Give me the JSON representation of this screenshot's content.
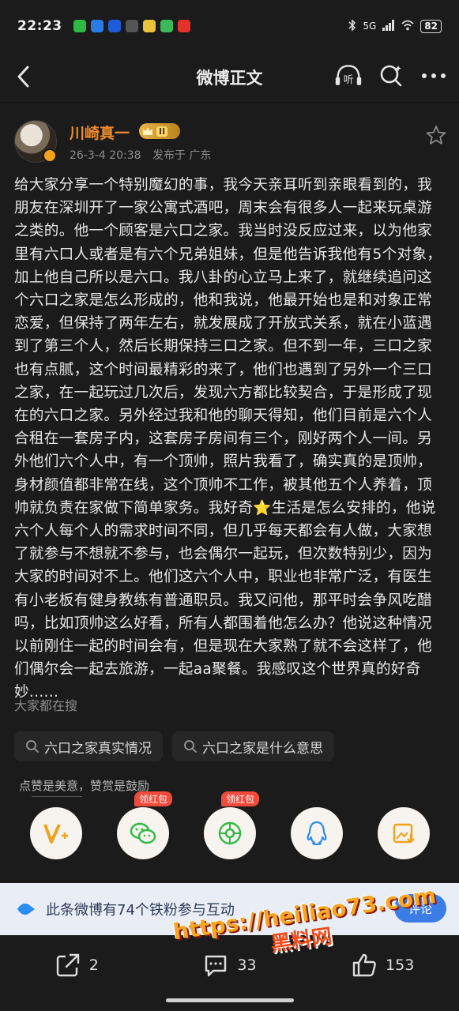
{
  "status_bar": {
    "time": "22:23",
    "signal": "5G",
    "battery": "82"
  },
  "nav": {
    "title": "微博正文",
    "listen_label": "听"
  },
  "post": {
    "author": "川崎真一",
    "vip_level": "II",
    "timestamp": "26-3-4 20:38",
    "location": "发布于 广东",
    "body": "给大家分享一个特别魔幻的事，我今天亲耳听到亲眼看到的，我朋友在深圳开了一家公寓式酒吧，周末会有很多人一起来玩桌游之类的。他一个顾客是六口之家。我当时没反应过来，以为他家里有六口人或者是有六个兄弟姐妹，但是他告诉我他有5个对象，加上他自己所以是六口。我八卦的心立马上来了，就继续追问这个六口之家是怎么形成的，他和我说，他最开始也是和对象正常恋爱，但保持了两年左右，就发展成了开放式关系，就在小蓝遇到了第三个人，然后长期保持三口之家。但不到一年，三口之家也有点腻，这个时间最精彩的来了，他们也遇到了另外一个三口之家，在一起玩过几次后，发现六方都比较契合，于是形成了现在的六口之家。另外经过我和他的聊天得知，他们目前是六个人合租在一套房子内，这套房子房间有三个，刚好两个人一间。另外他们六个人中，有一个顶帅，照片我看了，确实真的是顶帅，身材颜值都非常在线，这个顶帅不工作，被其他五个人养着，顶帅就负责在家做下简单家务。我好奇⭐生活是怎么安排的，他说六个人每个人的需求时间不同，但几乎每天都会有人做，大家想了就参与不想就不参与，也会偶尔一起玩，但次数特别少，因为大家的时间对不上。他们这六个人中，职业也非常广泛，有医生有小老板有健身教练有普通职员。我又问他，那平时会争风吃醋吗，比如顶帅这么好看，所有人都围着他怎么办？他说这种情况以前刚住一起的时间会有，但是现在大家熟了就不会这样了，他们偶尔会一起去旅游，一起aa聚餐。我感叹这个世界真的好奇妙......"
  },
  "search": {
    "header": "大家都在搜",
    "chips": [
      "六口之家真实情况",
      "六口之家是什么意思"
    ]
  },
  "reward": {
    "hint": "点赞是美意，赞赏是鼓励",
    "red_packet_label": "领红包"
  },
  "fan_banner": {
    "text": "此条微博有74个铁粉参与互动",
    "button": "评论"
  },
  "bottom_bar": {
    "share_count": "2",
    "comment_count": "33",
    "like_count": "153"
  },
  "watermark": {
    "url": "https://heiliao73.com",
    "name": "黑料网"
  },
  "colors": {
    "background": "#1b1b1b",
    "author_name": "#f08a2b",
    "banner_bg": "#e9eef6",
    "red_tag": "#f04a3a"
  }
}
